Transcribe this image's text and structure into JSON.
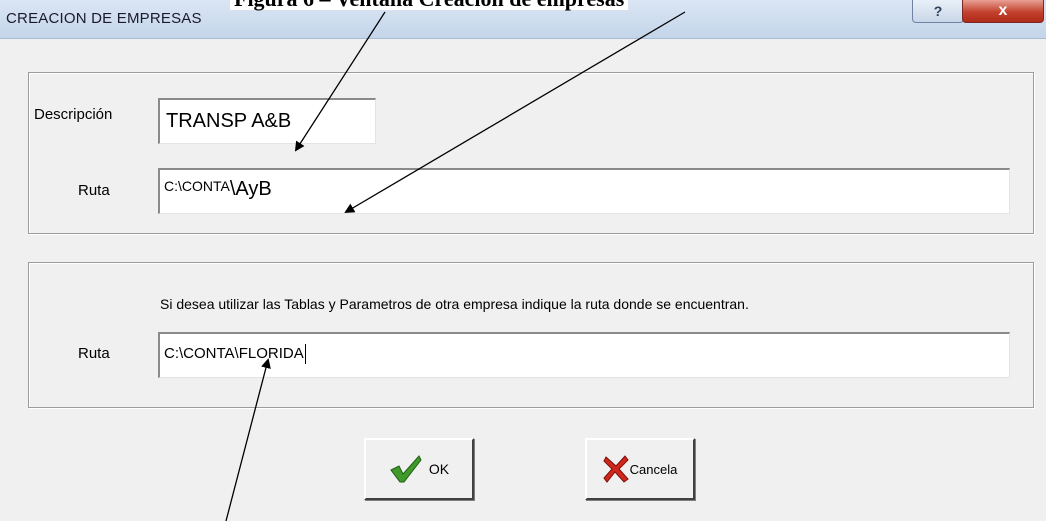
{
  "figure_caption": "Figura 6 – Ventana Creación de empresas",
  "window": {
    "title": "CREACION DE EMPRESAS",
    "help_glyph": "?",
    "close_glyph": "x"
  },
  "group1": {
    "description_label": "Descripción",
    "description_value": "TRANSP A&B",
    "ruta_label": "Ruta",
    "ruta_value_part1": "C:\\CONTA",
    "ruta_value_part2": "\\AyB"
  },
  "group2": {
    "hint": "Si desea utilizar las Tablas y Parametros de otra empresa indique la ruta donde se encuentran.",
    "ruta_label": "Ruta",
    "ruta_value": "C:\\CONTA\\FLORIDA"
  },
  "buttons": {
    "ok_label": "OK",
    "cancel_label": "Cancela"
  },
  "icons": {
    "ok": "checkmark-icon",
    "cancel": "red-x-icon"
  },
  "colors": {
    "check_green": "#3f9a2a",
    "cancel_red": "#d0261c",
    "close_red": "#c2412e"
  }
}
